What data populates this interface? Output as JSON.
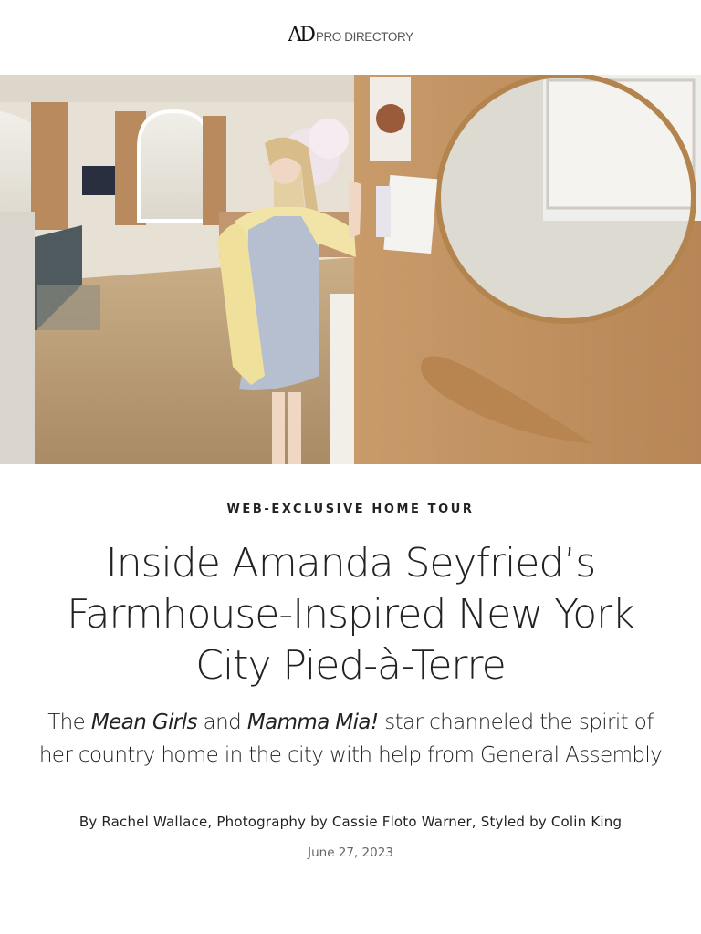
{
  "header": {
    "logo_mark": "AD",
    "logo_text": "PRO DIRECTORY"
  },
  "hero": {
    "icon": "photo"
  },
  "article": {
    "rubric": "WEB-EXCLUSIVE HOME TOUR",
    "headline": "Inside Amanda Seyfried’s Farmhouse-Inspired New York City Pied-à-Terre",
    "dek": {
      "part1": "The ",
      "part2": "Mean Girls",
      "part3": " and ",
      "part4": "Mamma Mia!",
      "part5": " star channeled the spirit of her country home in the city with help from General Assembly"
    },
    "byline": "By Rachel Wallace, Photography by Cassie Floto Warner, Styled by Colin King",
    "date": "June 27, 2023"
  }
}
